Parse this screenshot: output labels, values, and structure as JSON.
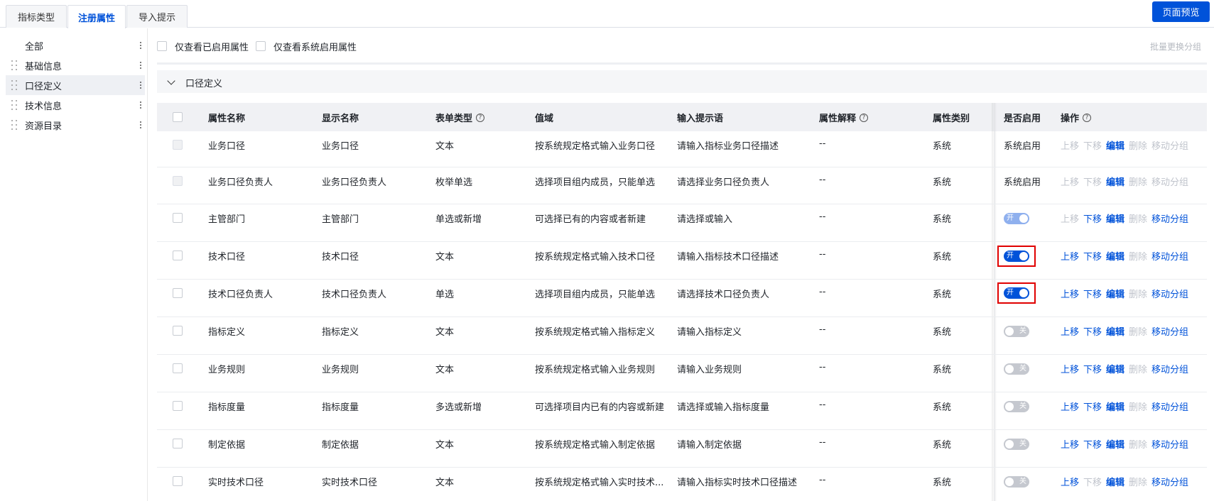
{
  "tabs": [
    {
      "label": "指标类型"
    },
    {
      "label": "注册属性"
    },
    {
      "label": "导入提示"
    }
  ],
  "preview_button": "页面预览",
  "sidebar": {
    "items": [
      {
        "label": "全部"
      },
      {
        "label": "基础信息"
      },
      {
        "label": "口径定义"
      },
      {
        "label": "技术信息"
      },
      {
        "label": "资源目录"
      }
    ]
  },
  "filters": {
    "only_enabled": "仅查看已启用属性",
    "only_system_enabled": "仅查看系统启用属性",
    "batch_move": "批量更换分组"
  },
  "group": {
    "title": "口径定义"
  },
  "table": {
    "headers": {
      "attr_name": "属性名称",
      "display_name": "显示名称",
      "form_type": "表单类型",
      "domain": "值域",
      "input_hint": "输入提示语",
      "attr_desc": "属性解释",
      "attr_category": "属性类别",
      "enabled": "是否启用",
      "ops": "操作"
    },
    "help_icon": "?",
    "op_labels": {
      "up": "上移",
      "down": "下移",
      "edit": "编辑",
      "delete": "删除",
      "move_group": "移动分组"
    },
    "switch_labels": {
      "on": "开",
      "off": "关"
    },
    "rows": [
      {
        "name": "业务口径",
        "display": "业务口径",
        "type": "文本",
        "domain": "按系统规定格式输入业务口径",
        "hint": "请输入指标业务口径描述",
        "desc": "--",
        "category": "系统",
        "enabled_text": "系统启用"
      },
      {
        "name": "业务口径负责人",
        "display": "业务口径负责人",
        "type": "枚举单选",
        "domain": "选择项目组内成员，只能单选",
        "hint": "请选择业务口径负责人",
        "desc": "--",
        "category": "系统",
        "enabled_text": "系统启用"
      },
      {
        "name": "主管部门",
        "display": "主管部门",
        "type": "单选或新增",
        "domain": "可选择已有的内容或者新建",
        "hint": "请选择或输入",
        "desc": "--",
        "category": "系统",
        "enabled_text": ""
      },
      {
        "name": "技术口径",
        "display": "技术口径",
        "type": "文本",
        "domain": "按系统规定格式输入技术口径",
        "hint": "请输入指标技术口径描述",
        "desc": "--",
        "category": "系统",
        "enabled_text": ""
      },
      {
        "name": "技术口径负责人",
        "display": "技术口径负责人",
        "type": "单选",
        "domain": "选择项目组内成员，只能单选",
        "hint": "请选择技术口径负责人",
        "desc": "--",
        "category": "系统",
        "enabled_text": ""
      },
      {
        "name": "指标定义",
        "display": "指标定义",
        "type": "文本",
        "domain": "按系统规定格式输入指标定义",
        "hint": "请输入指标定义",
        "desc": "--",
        "category": "系统",
        "enabled_text": ""
      },
      {
        "name": "业务规则",
        "display": "业务规则",
        "type": "文本",
        "domain": "按系统规定格式输入业务规则",
        "hint": "请输入业务规则",
        "desc": "--",
        "category": "系统",
        "enabled_text": ""
      },
      {
        "name": "指标度量",
        "display": "指标度量",
        "type": "多选或新增",
        "domain": "可选择项目内已有的内容或新建",
        "hint": "请选择或输入指标度量",
        "desc": "--",
        "category": "系统",
        "enabled_text": ""
      },
      {
        "name": "制定依据",
        "display": "制定依据",
        "type": "文本",
        "domain": "按系统规定格式输入制定依据",
        "hint": "请输入制定依据",
        "desc": "--",
        "category": "系统",
        "enabled_text": ""
      },
      {
        "name": "实时技术口径",
        "display": "实时技术口径",
        "type": "文本",
        "domain": "按系统规定格式输入实时技术...",
        "hint": "请输入指标实时技术口径描述",
        "desc": "--",
        "category": "系统",
        "enabled_text": ""
      }
    ]
  }
}
